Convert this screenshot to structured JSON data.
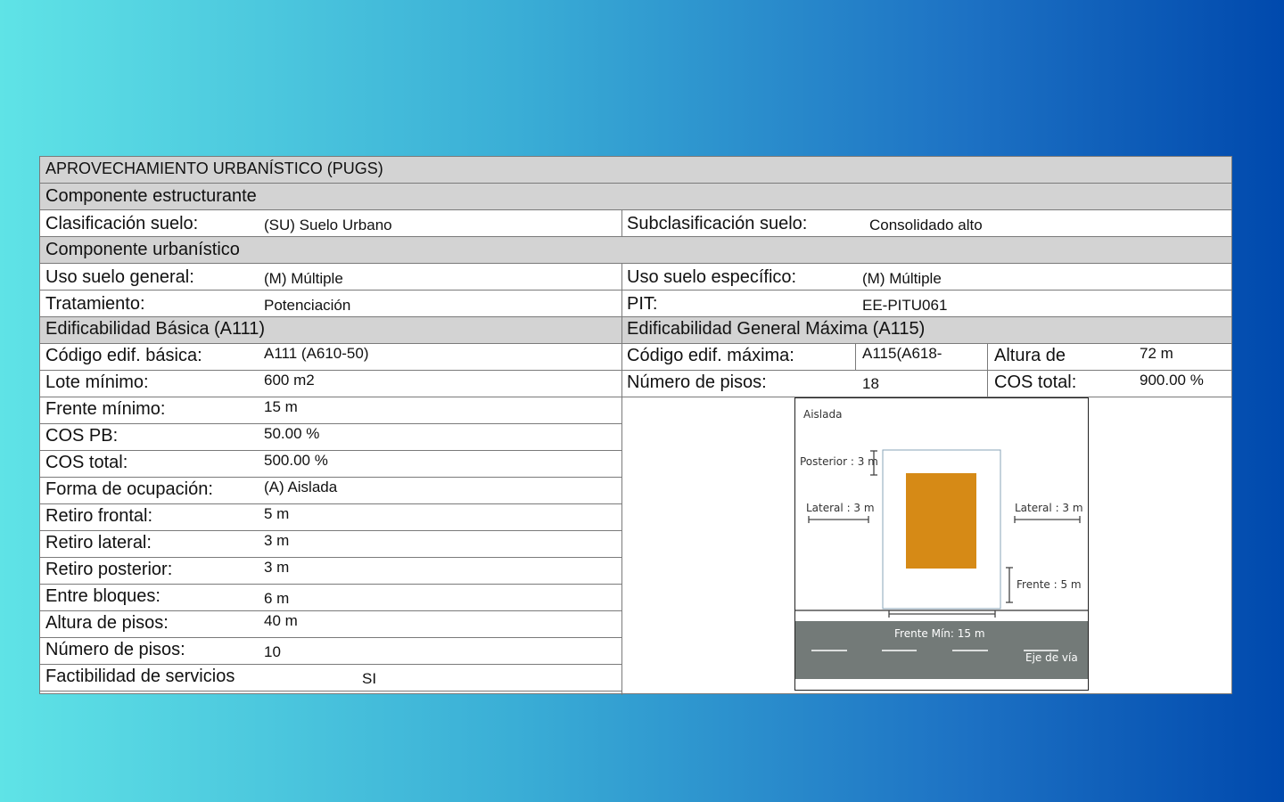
{
  "title": "APROVECHAMIENTO URBANÍSTICO (PUGS)",
  "sections": {
    "estructurante": "Componente  estructurante",
    "urbanistico": "Componente  urbanístico",
    "basica": "Edificabilidad Básica (A111)",
    "maxima": "Edificabilidad General Máxima (A115)"
  },
  "clasificacion": {
    "label": "Clasificación suelo:",
    "value": "(SU) Suelo Urbano",
    "sub_label": "Subclasificación suelo:",
    "sub_value": "Consolidado alto"
  },
  "uso": {
    "general_label": "Uso suelo general:",
    "general_value": "(M) Múltiple",
    "especifico_label": "Uso suelo específico:",
    "especifico_value": "(M) Múltiple"
  },
  "tratamiento": {
    "label": "Tratamiento:",
    "value": "Potenciación",
    "pit_label": "PIT:",
    "pit_value": "EE-PITU061"
  },
  "maxima": {
    "codigo_label": "Código edif. máxima:",
    "codigo_value": "A115(A618-",
    "altura_label": "Altura de",
    "altura_value": "72 m",
    "pisos_label": "Número de pisos:",
    "pisos_value": "18",
    "cos_label": "COS total:",
    "cos_value": "900.00 %"
  },
  "basica_rows": [
    {
      "label": "Código edif. básica:",
      "value": "A111 (A610-50)"
    },
    {
      "label": "Lote mínimo:",
      "value": "600 m2"
    },
    {
      "label": "Frente mínimo:",
      "value": "15 m"
    },
    {
      "label": "COS PB:",
      "value": "50.00 %"
    },
    {
      "label": "COS total:",
      "value": "500.00 %"
    },
    {
      "label": "Forma de ocupación:",
      "value": "(A) Aislada"
    },
    {
      "label": "Retiro frontal:",
      "value": "5 m"
    },
    {
      "label": "Retiro lateral:",
      "value": "3 m"
    },
    {
      "label": "Retiro posterior:",
      "value": "3 m"
    },
    {
      "label": "Entre bloques:",
      "value": "6 m"
    },
    {
      "label": "Altura de pisos:",
      "value": "40 m"
    },
    {
      "label": "Número de pisos:",
      "value": "10"
    },
    {
      "label": "Factibilidad de servicios",
      "value": "SI"
    }
  ],
  "diagram": {
    "type": "Aislada",
    "posterior": "Posterior : 3 m",
    "lateral_left": "Lateral : 3 m",
    "lateral_right": "Lateral : 3 m",
    "frente": "Frente : 5 m",
    "frente_min": "Frente Mín: 15 m",
    "eje": "Eje de vía",
    "building_color": "#d68a16",
    "road_color": "#737a78"
  }
}
